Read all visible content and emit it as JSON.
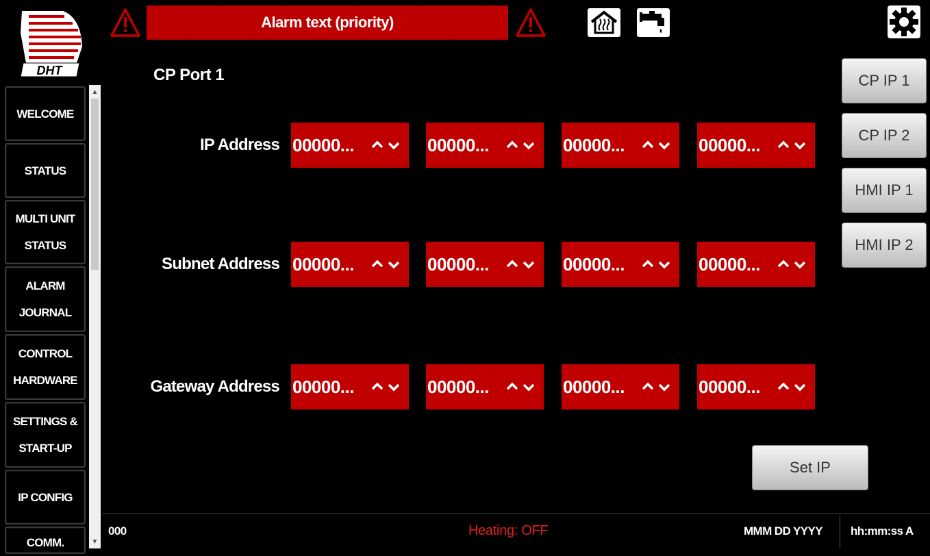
{
  "header": {
    "alarm_text": "Alarm text (priority)",
    "icons": [
      "warning-icon",
      "warning-icon",
      "house-heating-icon",
      "faucet-icon",
      "settings-gear-icon"
    ]
  },
  "logo": {
    "text": "DHT"
  },
  "sidebar": {
    "items": [
      {
        "lines": [
          "WELCOME"
        ]
      },
      {
        "lines": [
          "STATUS"
        ]
      },
      {
        "lines": [
          "MULTI UNIT",
          "STATUS"
        ]
      },
      {
        "lines": [
          "ALARM",
          "JOURNAL"
        ]
      },
      {
        "lines": [
          "CONTROL",
          "HARDWARE"
        ]
      },
      {
        "lines": [
          "SETTINGS &",
          "START-UP"
        ]
      },
      {
        "lines": [
          "IP CONFIG"
        ]
      },
      {
        "lines": [
          "COMM."
        ]
      }
    ]
  },
  "main": {
    "title": "CP Port 1",
    "rows": [
      {
        "label": "IP Address",
        "octets": [
          "00000...",
          "00000...",
          "00000...",
          "00000..."
        ]
      },
      {
        "label": "Subnet Address",
        "octets": [
          "00000...",
          "00000...",
          "00000...",
          "00000..."
        ]
      },
      {
        "label": "Gateway Address",
        "octets": [
          "00000...",
          "00000...",
          "00000...",
          "00000..."
        ]
      }
    ]
  },
  "right_buttons": [
    "CP IP 1",
    "CP IP 2",
    "HMI IP 1",
    "HMI IP 2"
  ],
  "set_ip_label": "Set IP",
  "status_bar": {
    "code": "000",
    "heating": "Heating: OFF",
    "date": "MMM DD YYYY",
    "time": "hh:mm:ss A"
  },
  "colors": {
    "accent_red": "#c00000",
    "background": "#000000",
    "heating_text": "#e02020"
  }
}
